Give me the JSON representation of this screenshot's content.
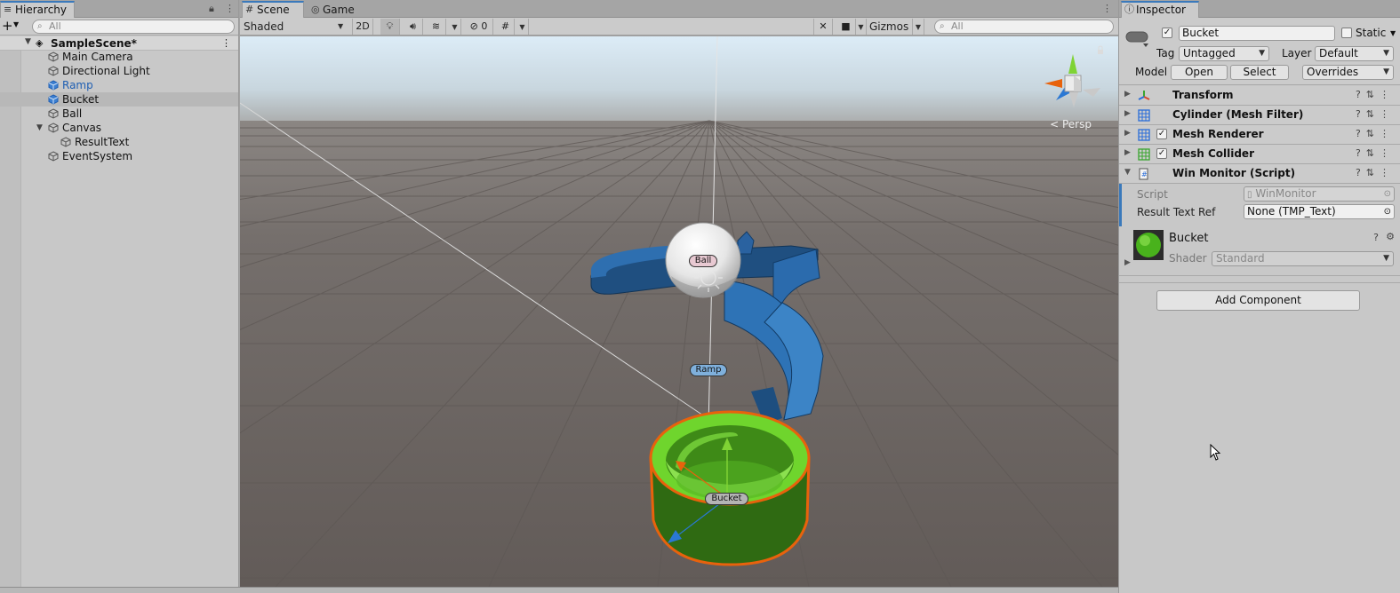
{
  "hierarchy": {
    "tab_label": "Hierarchy",
    "search_placeholder": "All",
    "scene_name": "SampleScene*",
    "items": [
      {
        "label": "Main Camera",
        "indent": 1,
        "style": "normal"
      },
      {
        "label": "Directional Light",
        "indent": 1,
        "style": "normal"
      },
      {
        "label": "Ramp",
        "indent": 1,
        "style": "prefab"
      },
      {
        "label": "Bucket",
        "indent": 1,
        "style": "selected"
      },
      {
        "label": "Ball",
        "indent": 1,
        "style": "normal"
      },
      {
        "label": "Canvas",
        "indent": 1,
        "style": "expanded"
      },
      {
        "label": "ResultText",
        "indent": 2,
        "style": "normal"
      },
      {
        "label": "EventSystem",
        "indent": 1,
        "style": "normal"
      }
    ]
  },
  "scene": {
    "tabs": [
      {
        "label": "Scene",
        "active": true,
        "icon": "grid-icon"
      },
      {
        "label": "Game",
        "active": false,
        "icon": "gamepad-icon"
      }
    ],
    "shading_mode": "Shaded",
    "mode_2d": "2D",
    "hidden_count": "0",
    "gizmos_label": "Gizmos",
    "search_placeholder": "All",
    "persp_label": "< Persp",
    "object_labels": {
      "ball": "Ball",
      "ramp": "Ramp",
      "bucket": "Bucket"
    }
  },
  "inspector": {
    "tab_label": "Inspector",
    "object_name": "Bucket",
    "active": true,
    "static_label": "Static",
    "tag_label": "Tag",
    "tag_value": "Untagged",
    "layer_label": "Layer",
    "layer_value": "Default",
    "model_label": "Model",
    "open_label": "Open",
    "select_label": "Select",
    "overrides_label": "Overrides",
    "components": [
      {
        "title": "Transform",
        "icon": "transform-icon",
        "has_checkbox": false,
        "expanded": false
      },
      {
        "title": "Cylinder (Mesh Filter)",
        "icon": "mesh-filter-icon",
        "has_checkbox": false,
        "expanded": false
      },
      {
        "title": "Mesh Renderer",
        "icon": "mesh-renderer-icon",
        "has_checkbox": true,
        "expanded": false
      },
      {
        "title": "Mesh Collider",
        "icon": "mesh-collider-icon",
        "has_checkbox": true,
        "expanded": false
      },
      {
        "title": "Win Monitor (Script)",
        "icon": "script-icon",
        "has_checkbox": false,
        "expanded": true
      }
    ],
    "script_props": {
      "script_label": "Script",
      "script_value": "WinMonitor",
      "result_label": "Result Text Ref",
      "result_value": "None (TMP_Text)"
    },
    "material": {
      "name": "Bucket",
      "shader_label": "Shader",
      "shader_value": "Standard"
    },
    "add_component_label": "Add Component"
  },
  "colors": {
    "accent_blue": "#3a79bb",
    "bucket_green": "#6fd52d",
    "ramp_blue": "#2d6eae",
    "selection_orange": "#e8620c"
  }
}
